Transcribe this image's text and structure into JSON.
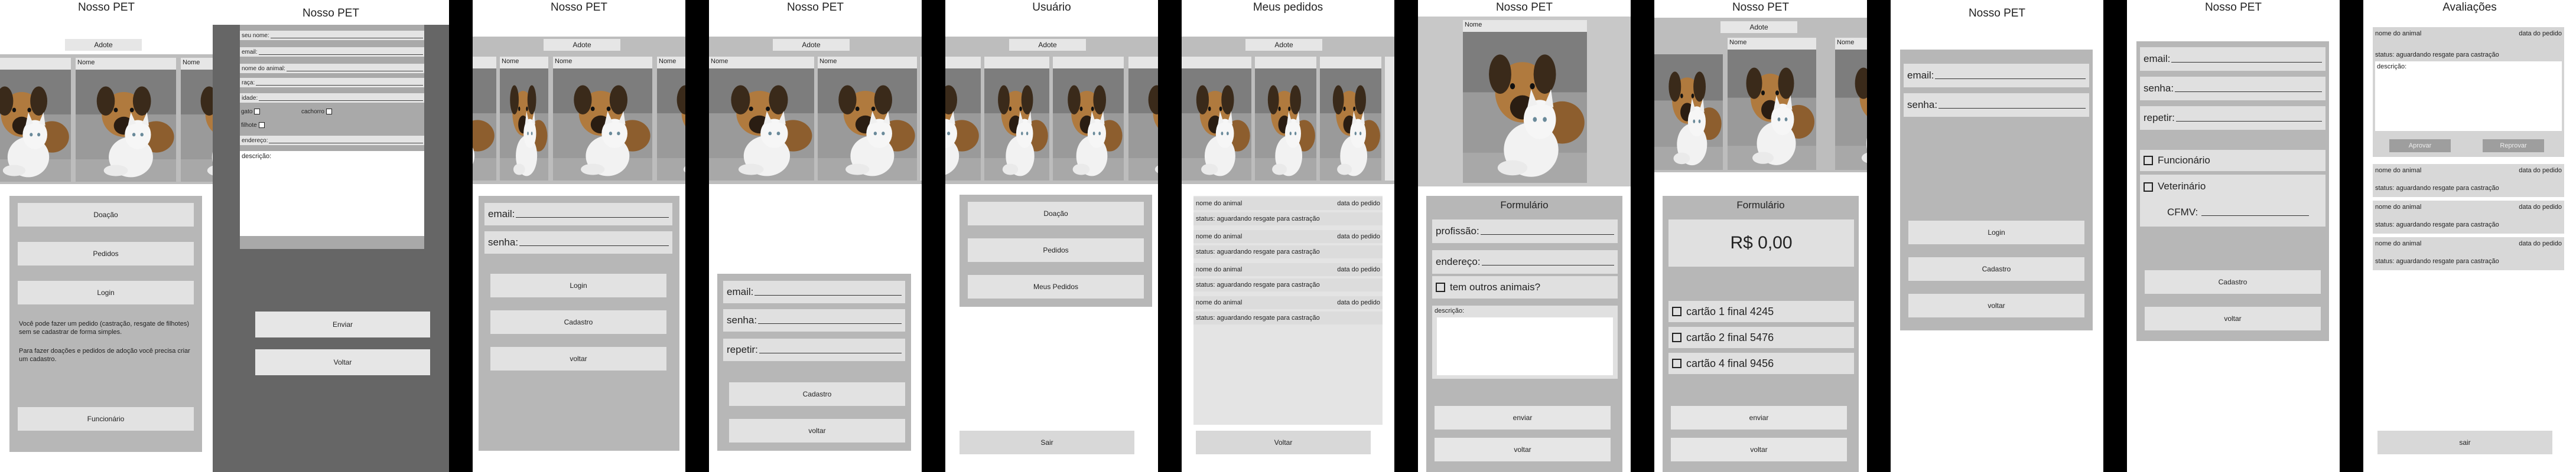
{
  "app_title": "Nosso PET",
  "photo_caption": "Nome",
  "adote_pill": "Adote",
  "s1": {
    "buttons": [
      "Doação",
      "Pedidos",
      "Login"
    ],
    "info1": "Você pode fazer um pedido (castração, resgate de filhotes) sem se cadastrar de forma simples.",
    "info2": "Para fazer doações e pedidos de adoção você precisa criar um cadastro.",
    "funcionario": "Funcionário"
  },
  "s2": {
    "fields": [
      "seu nome:",
      "email:",
      "nome do animal:",
      "raça:",
      "idade:"
    ],
    "gato": "gato",
    "cachorro": "cachorro",
    "filhote": "filhote",
    "endereco": "endereço:",
    "descricao": "descrição:",
    "enviar": "Enviar",
    "voltar": "Voltar"
  },
  "s3": {
    "email": "email:",
    "senha": "senha:",
    "login": "Login",
    "cadastro": "Cadastro",
    "voltar": "voltar"
  },
  "s4": {
    "email": "email:",
    "senha": "senha:",
    "repetir": "repetir:",
    "cadastro": "Cadastro",
    "voltar": "voltar"
  },
  "s5": {
    "title": "Usuário",
    "buttons": [
      "Doação",
      "Pedidos",
      "Meus Pedidos"
    ],
    "sair": "Sair"
  },
  "s6": {
    "title": "Meus pedidos",
    "nome": "nome do animal",
    "data": "data do pedido",
    "status": "status:  aguardando resgate para castração",
    "voltar": "Voltar"
  },
  "s7": {
    "form_title": "Formulário",
    "profissao": "profissão:",
    "endereco": "endereço:",
    "outros": "tem outros animais?",
    "descricao": "descrição:",
    "enviar": "enviar",
    "voltar": "voltar"
  },
  "s8": {
    "form_title": "Formulário",
    "price": "R$  0,00",
    "cards": [
      "cartão 1 final 4245",
      "cartão 2 final 5476",
      "cartão 4 final 9456"
    ],
    "enviar": "enviar",
    "voltar": "voltar"
  },
  "s9": {
    "email": "email:",
    "senha": "senha:",
    "login": "Login",
    "cadastro": "Cadastro",
    "voltar": "voltar"
  },
  "s10": {
    "email": "email:",
    "senha": "senha:",
    "repetir": "repetir:",
    "funcionario": "Funcionário",
    "veterinario": "Veterinário",
    "cfmv": "CFMV:",
    "cadastro": "Cadastro",
    "voltar": "voltar"
  },
  "s11": {
    "title": "Avaliações",
    "nome": "nome do animal",
    "data": "data do pedido",
    "status": "status:  aguardando resgate para castração",
    "descricao": "descrição:",
    "aprovar": "Aprovar",
    "reprovar": "Reprovar",
    "sair": "sair"
  }
}
